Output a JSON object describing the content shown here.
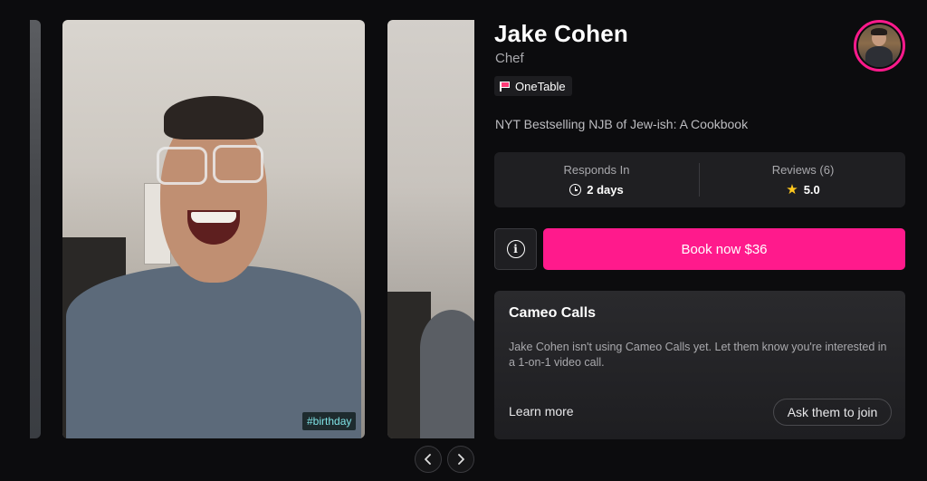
{
  "carousel": {
    "hashtag": "#birthday",
    "prev_icon": "chevron-left-icon",
    "next_icon": "chevron-right-icon"
  },
  "profile": {
    "name": "Jake Cohen",
    "occupation": "Chef",
    "charity_label": "OneTable",
    "charity_icon": "flag-icon",
    "bio": "NYT Bestselling NJB of Jew-ish: A Cookbook",
    "avatar_ring_color": "#ff1a8c"
  },
  "stats": {
    "responds_label": "Responds In",
    "responds_value": "2 days",
    "reviews_label": "Reviews (6)",
    "reviews_value": "5.0"
  },
  "actions": {
    "book_label": "Book now $36",
    "book_color": "#ff1a8c",
    "info_glyph": "i"
  },
  "cameo_calls": {
    "title": "Cameo Calls",
    "text": "Jake Cohen isn't using Cameo Calls yet. Let them know you're interested in a 1-on-1 video call.",
    "learn_more": "Learn more",
    "ask_button": "Ask them to join"
  }
}
